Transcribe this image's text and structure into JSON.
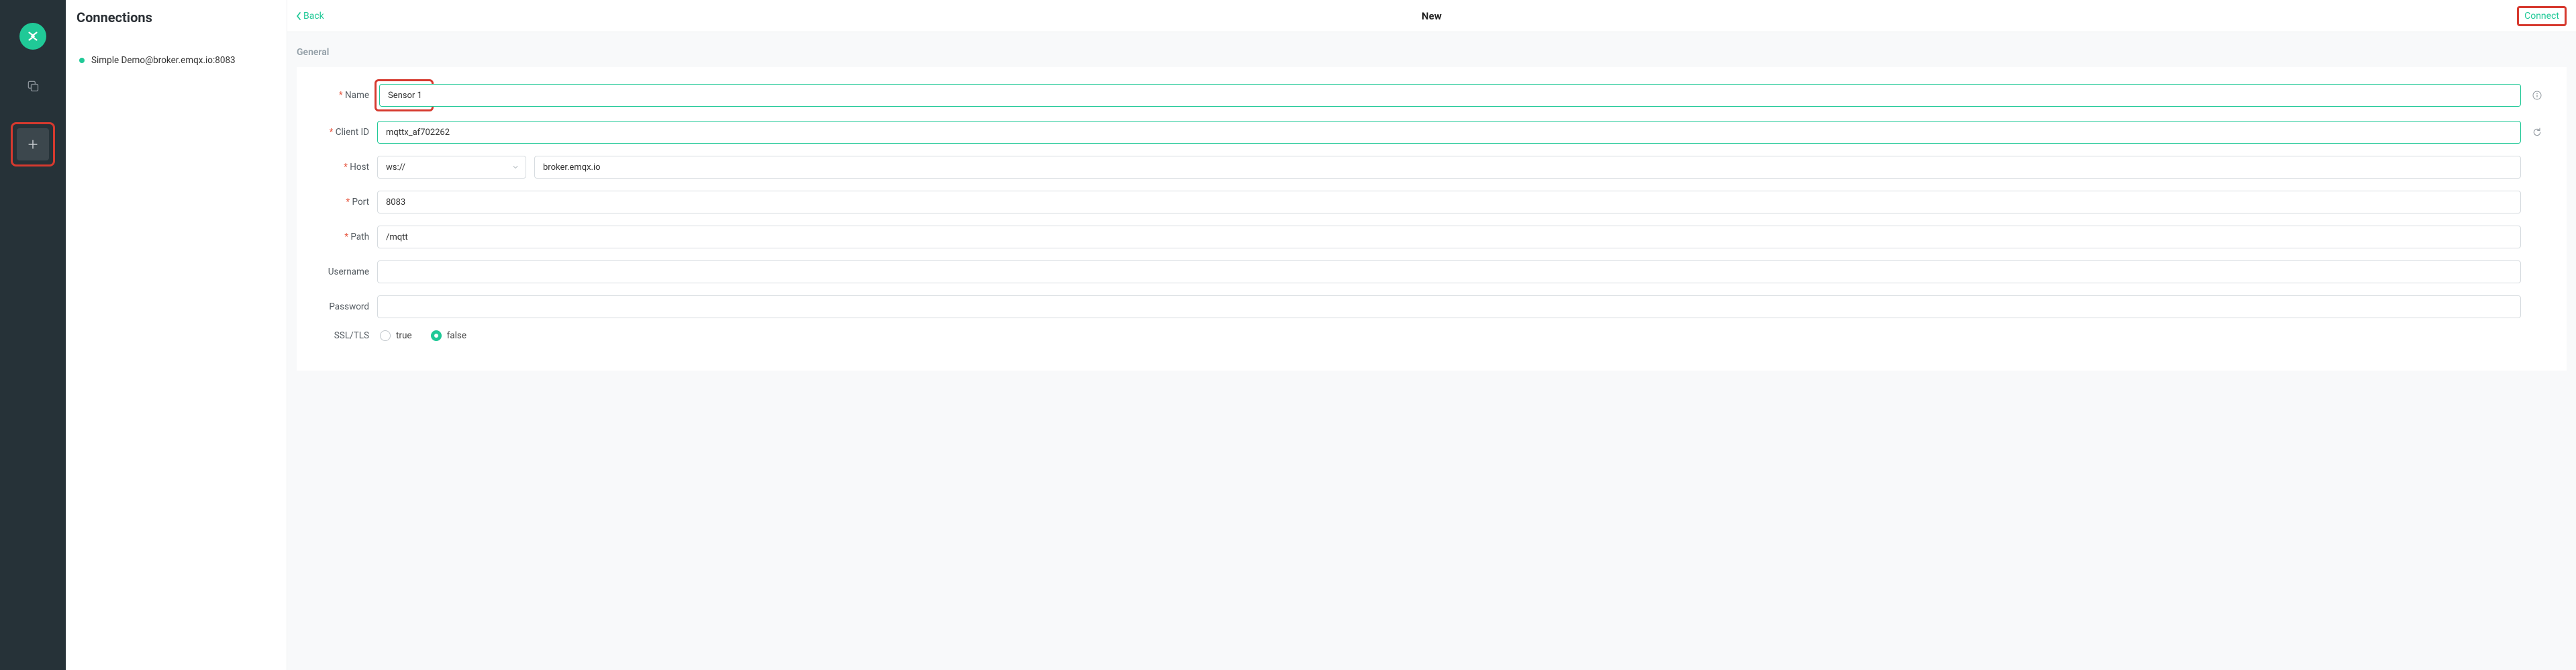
{
  "rail": {
    "icons": {
      "logo": "app-logo",
      "copy": "copy-stack-icon",
      "add": "plus-icon"
    }
  },
  "sidebar": {
    "title": "Connections",
    "items": [
      {
        "label": "Simple Demo@broker.emqx.io:8083",
        "status": "online"
      }
    ]
  },
  "topbar": {
    "back_label": "Back",
    "title": "New",
    "connect_label": "Connect"
  },
  "form": {
    "section_title": "General",
    "fields": {
      "name": {
        "label": "Name",
        "value": "Sensor 1",
        "required": true
      },
      "client_id": {
        "label": "Client ID",
        "value": "mqttx_af702262",
        "required": true
      },
      "host": {
        "label": "Host",
        "protocol": "ws://",
        "value": "broker.emqx.io",
        "required": true
      },
      "port": {
        "label": "Port",
        "value": "8083",
        "required": true
      },
      "path": {
        "label": "Path",
        "value": "/mqtt",
        "required": true
      },
      "username": {
        "label": "Username",
        "value": "",
        "required": false
      },
      "password": {
        "label": "Password",
        "value": "",
        "required": false
      },
      "ssltls": {
        "label": "SSL/TLS",
        "value": "false",
        "options": {
          "true": "true",
          "false": "false"
        },
        "required": false
      }
    }
  },
  "highlights": [
    "rail-add-button",
    "name-input-area",
    "connect-button"
  ]
}
